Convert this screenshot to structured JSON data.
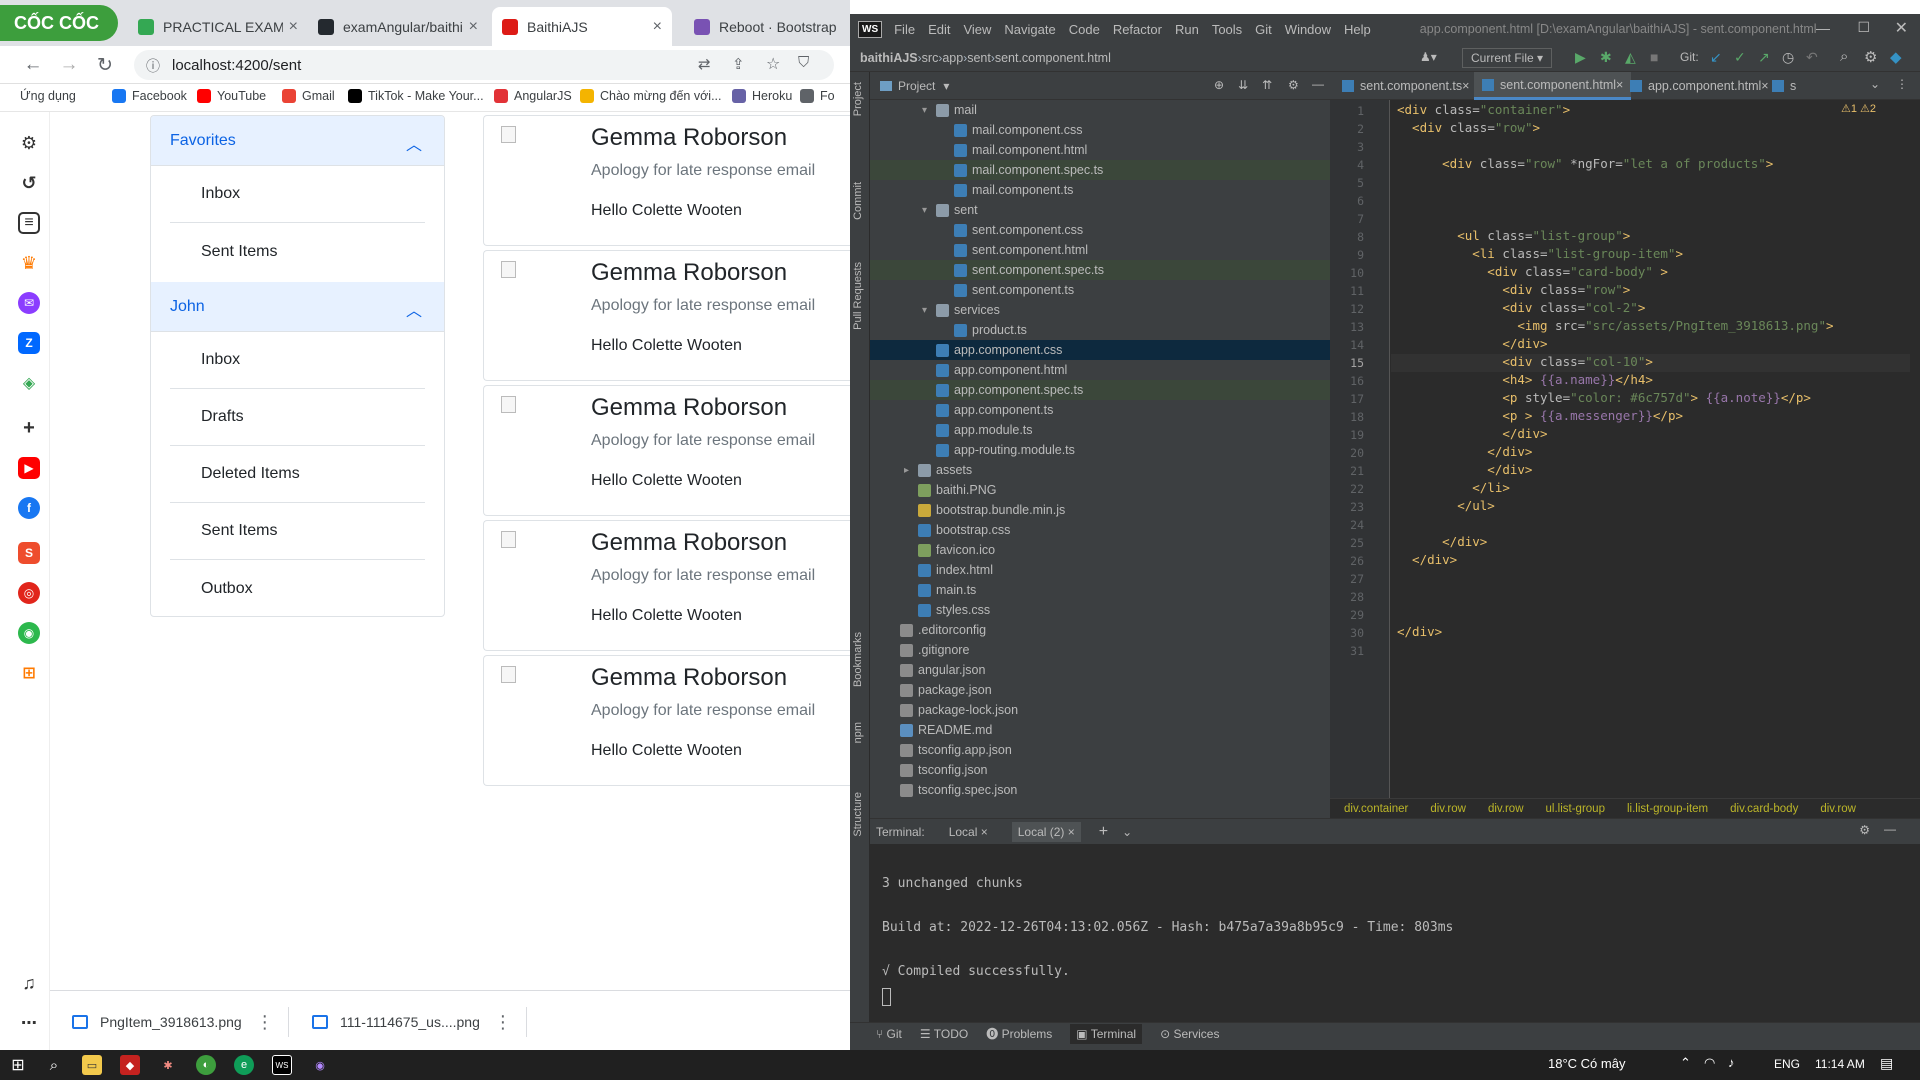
{
  "browser": {
    "brand": "CỐC CỐC",
    "tabs": [
      {
        "title": "PRACTICAL EXAM",
        "color": "#34a853"
      },
      {
        "title": "examAngular/baithi",
        "color": "#24292f"
      },
      {
        "title": "BaithiAJS",
        "color": "#dd1b16"
      },
      {
        "title": "Reboot · Bootstrap",
        "color": "#7952b3"
      }
    ],
    "url": "localhost:4200/sent",
    "bookmarks": [
      {
        "label": "Ứng dụng",
        "color": "#5f6368"
      },
      {
        "label": "Facebook",
        "color": "#1877f2"
      },
      {
        "label": "YouTube",
        "color": "#ff0000"
      },
      {
        "label": "Gmail",
        "color": "#ea4335"
      },
      {
        "label": "TikTok - Make Your...",
        "color": "#000000"
      },
      {
        "label": "AngularJS",
        "color": "#e23237"
      },
      {
        "label": "Chào mừng đến với...",
        "color": "#f4b400"
      },
      {
        "label": "Heroku",
        "color": "#6762a6"
      },
      {
        "label": "Fo",
        "color": "#5f6368"
      }
    ]
  },
  "accordion": {
    "sections": [
      {
        "title": "Favorites",
        "items": [
          "Inbox",
          "Sent Items"
        ]
      },
      {
        "title": "John",
        "items": [
          "Inbox",
          "Drafts",
          "Deleted Items",
          "Sent Items",
          "Outbox"
        ]
      }
    ]
  },
  "cards": [
    {
      "name": "Gemma Roborson",
      "note": "Apology for late response email",
      "messenger": "Hello Colette Wooten"
    },
    {
      "name": "Gemma Roborson",
      "note": "Apology for late response email",
      "messenger": "Hello Colette Wooten"
    },
    {
      "name": "Gemma Roborson",
      "note": "Apology for late response email",
      "messenger": "Hello Colette Wooten"
    },
    {
      "name": "Gemma Roborson",
      "note": "Apology for late response email",
      "messenger": "Hello Colette Wooten"
    },
    {
      "name": "Gemma Roborson",
      "note": "Apology for late response email",
      "messenger": "Hello Colette Wooten"
    }
  ],
  "downloads": [
    {
      "name": "PngItem_3918613.png"
    },
    {
      "name": "111-1114675_us....png"
    }
  ],
  "ide": {
    "logo": "WS",
    "menu": [
      "File",
      "Edit",
      "View",
      "Navigate",
      "Code",
      "Refactor",
      "Run",
      "Tools",
      "Git",
      "Window",
      "Help"
    ],
    "window_title": "app.component.html [D:\\examAngular\\baithiAJS] - sent.component.html",
    "nav_path": [
      "baithiAJS",
      "src",
      "app",
      "sent",
      "sent.component.html"
    ],
    "run_config": "Current File",
    "git_label": "Git:",
    "project_label": "Project",
    "left_strip": [
      "Project",
      "Commit",
      "Pull Requests",
      "Bookmarks",
      "npm",
      "Structure"
    ],
    "tree": [
      {
        "name": "mail",
        "depth": 3,
        "type": "folder",
        "open": true
      },
      {
        "name": "mail.component.css",
        "depth": 4,
        "type": "css"
      },
      {
        "name": "mail.component.html",
        "depth": 4,
        "type": "html"
      },
      {
        "name": "mail.component.spec.ts",
        "depth": 4,
        "type": "ts",
        "hl": true
      },
      {
        "name": "mail.component.ts",
        "depth": 4,
        "type": "ts"
      },
      {
        "name": "sent",
        "depth": 3,
        "type": "folder",
        "open": true
      },
      {
        "name": "sent.component.css",
        "depth": 4,
        "type": "css"
      },
      {
        "name": "sent.component.html",
        "depth": 4,
        "type": "html"
      },
      {
        "name": "sent.component.spec.ts",
        "depth": 4,
        "type": "ts",
        "hl": true
      },
      {
        "name": "sent.component.ts",
        "depth": 4,
        "type": "ts"
      },
      {
        "name": "services",
        "depth": 3,
        "type": "folder",
        "open": true
      },
      {
        "name": "product.ts",
        "depth": 4,
        "type": "ts"
      },
      {
        "name": "app.component.css",
        "depth": 3,
        "type": "css",
        "sel": true
      },
      {
        "name": "app.component.html",
        "depth": 3,
        "type": "html"
      },
      {
        "name": "app.component.spec.ts",
        "depth": 3,
        "type": "ts",
        "hl": true
      },
      {
        "name": "app.component.ts",
        "depth": 3,
        "type": "ts"
      },
      {
        "name": "app.module.ts",
        "depth": 3,
        "type": "ts"
      },
      {
        "name": "app-routing.module.ts",
        "depth": 3,
        "type": "ts"
      },
      {
        "name": "assets",
        "depth": 2,
        "type": "folder",
        "open": false
      },
      {
        "name": "baithi.PNG",
        "depth": 2,
        "type": "img"
      },
      {
        "name": "bootstrap.bundle.min.js",
        "depth": 2,
        "type": "js"
      },
      {
        "name": "bootstrap.css",
        "depth": 2,
        "type": "css"
      },
      {
        "name": "favicon.ico",
        "depth": 2,
        "type": "img"
      },
      {
        "name": "index.html",
        "depth": 2,
        "type": "html"
      },
      {
        "name": "main.ts",
        "depth": 2,
        "type": "ts"
      },
      {
        "name": "styles.css",
        "depth": 2,
        "type": "css"
      },
      {
        "name": ".editorconfig",
        "depth": 1,
        "type": "cfg"
      },
      {
        "name": ".gitignore",
        "depth": 1,
        "type": "cfg"
      },
      {
        "name": "angular.json",
        "depth": 1,
        "type": "json"
      },
      {
        "name": "package.json",
        "depth": 1,
        "type": "json"
      },
      {
        "name": "package-lock.json",
        "depth": 1,
        "type": "json"
      },
      {
        "name": "README.md",
        "depth": 1,
        "type": "md"
      },
      {
        "name": "tsconfig.app.json",
        "depth": 1,
        "type": "json"
      },
      {
        "name": "tsconfig.json",
        "depth": 1,
        "type": "json"
      },
      {
        "name": "tsconfig.spec.json",
        "depth": 1,
        "type": "json"
      }
    ],
    "editor_tabs": [
      {
        "title": "sent.component.ts",
        "active": false
      },
      {
        "title": "sent.component.html",
        "active": true
      },
      {
        "title": "app.component.html",
        "active": false
      },
      {
        "title": "s",
        "active": false
      }
    ],
    "inspections": "⚠1 ⚠2",
    "code_lines": [
      [
        {
          "t": "<div ",
          "c": "tag"
        },
        {
          "t": "class=",
          "c": "att"
        },
        {
          "t": "\"container\"",
          "c": "str"
        },
        {
          "t": ">",
          "c": "tag"
        }
      ],
      [
        {
          "t": "  <div ",
          "c": "tag"
        },
        {
          "t": "class=",
          "c": "att"
        },
        {
          "t": "\"row\"",
          "c": "str"
        },
        {
          "t": ">",
          "c": "tag"
        }
      ],
      [],
      [
        {
          "t": "      <div ",
          "c": "tag"
        },
        {
          "t": "class=",
          "c": "att"
        },
        {
          "t": "\"row\" ",
          "c": "str"
        },
        {
          "t": "*ngFor=",
          "c": "att"
        },
        {
          "t": "\"let a of products\"",
          "c": "str"
        },
        {
          "t": ">",
          "c": "tag"
        }
      ],
      [],
      [],
      [],
      [
        {
          "t": "        <ul ",
          "c": "tag"
        },
        {
          "t": "class=",
          "c": "att"
        },
        {
          "t": "\"list-group\"",
          "c": "str"
        },
        {
          "t": ">",
          "c": "tag"
        }
      ],
      [
        {
          "t": "          <li ",
          "c": "tag"
        },
        {
          "t": "class=",
          "c": "att"
        },
        {
          "t": "\"list-group-item\"",
          "c": "str"
        },
        {
          "t": ">",
          "c": "tag"
        }
      ],
      [
        {
          "t": "            <div ",
          "c": "tag"
        },
        {
          "t": "class=",
          "c": "att"
        },
        {
          "t": "\"card-body\" ",
          "c": "str"
        },
        {
          "t": ">",
          "c": "tag"
        }
      ],
      [
        {
          "t": "              <div ",
          "c": "tag"
        },
        {
          "t": "class=",
          "c": "att"
        },
        {
          "t": "\"row\"",
          "c": "str"
        },
        {
          "t": ">",
          "c": "tag"
        }
      ],
      [
        {
          "t": "              <div ",
          "c": "tag"
        },
        {
          "t": "class=",
          "c": "att"
        },
        {
          "t": "\"col-2\"",
          "c": "str"
        },
        {
          "t": ">",
          "c": "tag"
        }
      ],
      [
        {
          "t": "                <img ",
          "c": "tag"
        },
        {
          "t": "src=",
          "c": "att"
        },
        {
          "t": "\"src/assets/PngItem_3918613.png\"",
          "c": "str"
        },
        {
          "t": ">",
          "c": "tag"
        }
      ],
      [
        {
          "t": "              </div>",
          "c": "tag"
        }
      ],
      [
        {
          "t": "              <div ",
          "c": "tag"
        },
        {
          "t": "class=",
          "c": "att"
        },
        {
          "t": "\"col-10\"",
          "c": "str"
        },
        {
          "t": ">",
          "c": "tag"
        }
      ],
      [
        {
          "t": "              <h4>",
          "c": "tag"
        },
        {
          "t": " {{a.name}}",
          "c": "ang"
        },
        {
          "t": "</h4>",
          "c": "tag"
        }
      ],
      [
        {
          "t": "              <p ",
          "c": "tag"
        },
        {
          "t": "style=",
          "c": "att"
        },
        {
          "t": "\"color: #6c757d\"",
          "c": "str"
        },
        {
          "t": ">",
          "c": "tag"
        },
        {
          "t": " {{a.note}}",
          "c": "ang"
        },
        {
          "t": "</p>",
          "c": "tag"
        }
      ],
      [
        {
          "t": "              <p >",
          "c": "tag"
        },
        {
          "t": " {{a.messenger}}",
          "c": "ang"
        },
        {
          "t": "</p>",
          "c": "tag"
        }
      ],
      [
        {
          "t": "              </div>",
          "c": "tag"
        }
      ],
      [
        {
          "t": "            </div>",
          "c": "tag"
        }
      ],
      [
        {
          "t": "            </div>",
          "c": "tag"
        }
      ],
      [
        {
          "t": "          </li>",
          "c": "tag"
        }
      ],
      [
        {
          "t": "        </ul>",
          "c": "tag"
        }
      ],
      [],
      [
        {
          "t": "      </div>",
          "c": "tag"
        }
      ],
      [
        {
          "t": "  </div>",
          "c": "tag"
        }
      ],
      [],
      [],
      [],
      [
        {
          "t": "</div>",
          "c": "tag"
        }
      ],
      []
    ],
    "code_breadcrumb": [
      "div.container",
      "div.row",
      "div.row",
      "ul.list-group",
      "li.list-group-item",
      "div.card-body",
      "div.row"
    ],
    "terminal": {
      "label": "Terminal:",
      "tabs": [
        "Local",
        "Local (2)"
      ],
      "lines": [
        "3 unchanged chunks",
        "",
        "Build at: 2022-12-26T04:13:02.056Z - Hash: b475a7a39a8b95c9 - Time: 803ms",
        "",
        "√ Compiled successfully."
      ]
    },
    "toolwindows": [
      "Git",
      "TODO",
      "Problems",
      "Terminal",
      "Services"
    ]
  },
  "taskbar": {
    "weather": "18°C  Có mây",
    "lang": "ENG",
    "time": "11:14 AM"
  }
}
